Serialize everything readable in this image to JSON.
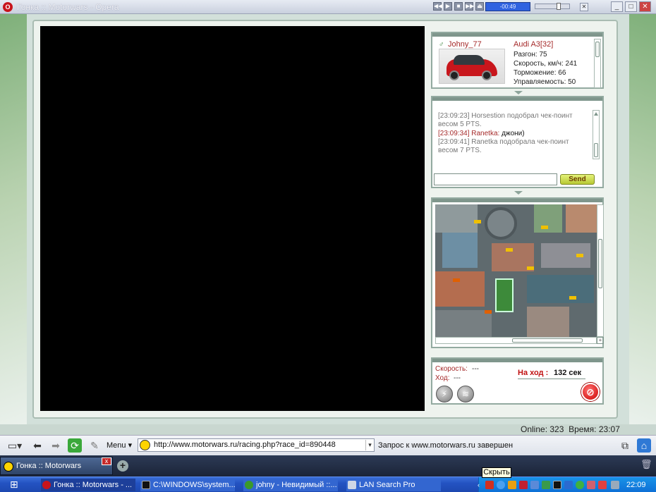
{
  "window": {
    "title": "Гонка :: Motorwars - Opera",
    "logo": "O"
  },
  "media": {
    "track_time": "-00:49",
    "buttons": [
      "◀◀",
      "▶",
      "■",
      "▶▶",
      "⏏"
    ]
  },
  "window_controls": {
    "minimize": "_",
    "maximize": "□",
    "close": "✕",
    "side_close": "✕"
  },
  "car": {
    "player": "Johny_77",
    "model": "Audi A3",
    "level": "[32]",
    "stats": [
      "Разгон: 75",
      "Скорость, км/ч: 241",
      "Торможение: 66",
      "Управляемость: 50"
    ]
  },
  "chat": {
    "messages": [
      {
        "time": "[23:09:23]",
        "name": "",
        "text": "Horsestion подобрал чек-поинт",
        "cont": "весом 5 PTS.",
        "type": "system"
      },
      {
        "time": "[23:09:34]",
        "name": "Ranetka:",
        "text": "джони)",
        "cont": "",
        "type": "user"
      },
      {
        "time": "[23:09:41]",
        "name": "",
        "text": "Ranetka подобрала чек-поинт",
        "cont": "весом 7 PTS.",
        "type": "system"
      }
    ],
    "input_value": "",
    "send_label": "Send"
  },
  "race_status": {
    "speed_label": "Скорость:",
    "speed_value": "---",
    "move_label": "Ход:",
    "move_value": "---",
    "turn_label": "На ход :",
    "turn_value": "132 сек"
  },
  "footer_info": {
    "online_label": "Online:",
    "online_value": "323",
    "time_label": "Время:",
    "time_value": "23:07"
  },
  "address_bar": {
    "menu_label": "Menu",
    "url": "http://www.motorwars.ru/racing.php?race_id=890448",
    "status": "Запрос к www.motorwars.ru завершен"
  },
  "tabs": [
    {
      "label": "Гонка :: Motorwars",
      "close": "x"
    }
  ],
  "taskbar": {
    "items": [
      {
        "label": "Гонка :: Motorwars - ...",
        "color": "#c8141c"
      },
      {
        "label": "C:\\WINDOWS\\system...",
        "color": "#111111"
      },
      {
        "label": "johny - Невидимый ::...",
        "color": "#3b9a2a"
      },
      {
        "label": "LAN Search Pro",
        "color": "#cfd7e6"
      }
    ],
    "clock": "22:09",
    "tooltip": "Скрыть"
  },
  "colors": {
    "accent": "#a52a2a",
    "send_button": "#c8d84a",
    "stop_button": "#d40000"
  }
}
